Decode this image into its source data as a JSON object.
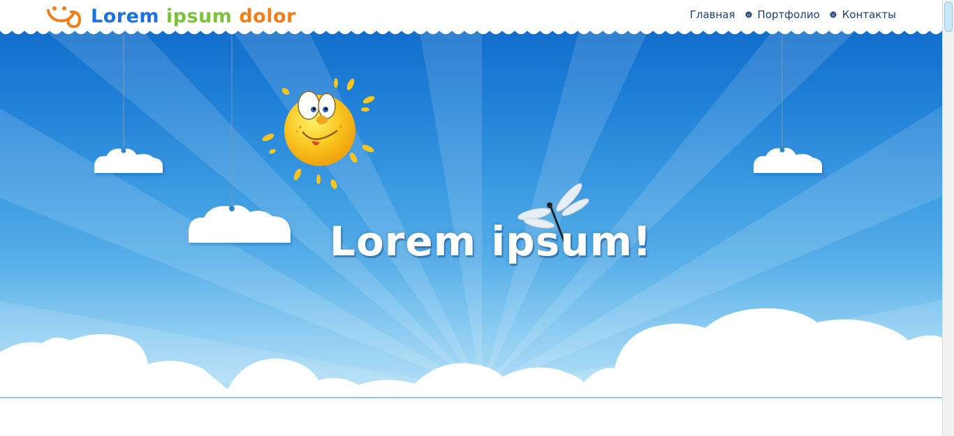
{
  "header": {
    "logo": {
      "word1": "Lorem",
      "word2": "ipsum",
      "word3": "dolor"
    },
    "nav": [
      {
        "label": "Главная"
      },
      {
        "label": "Портфолио"
      },
      {
        "label": "Контакты"
      }
    ]
  },
  "hero": {
    "title": "Lorem ipsum!"
  },
  "colors": {
    "logo_word1": "#1a73e0",
    "logo_word2": "#7cc23f",
    "logo_word3": "#f07e1b",
    "nav_text": "#1b3f70",
    "sky_top": "#0b66c6",
    "sky_bottom": "#8fd0f3",
    "sun": "#f9c51f"
  },
  "icons": {
    "logo": "smiley-logo-icon",
    "nav_separator": "smiley-bullet-icon",
    "sun": "sun-character-icon",
    "dragonfly": "dragonfly-icon"
  }
}
